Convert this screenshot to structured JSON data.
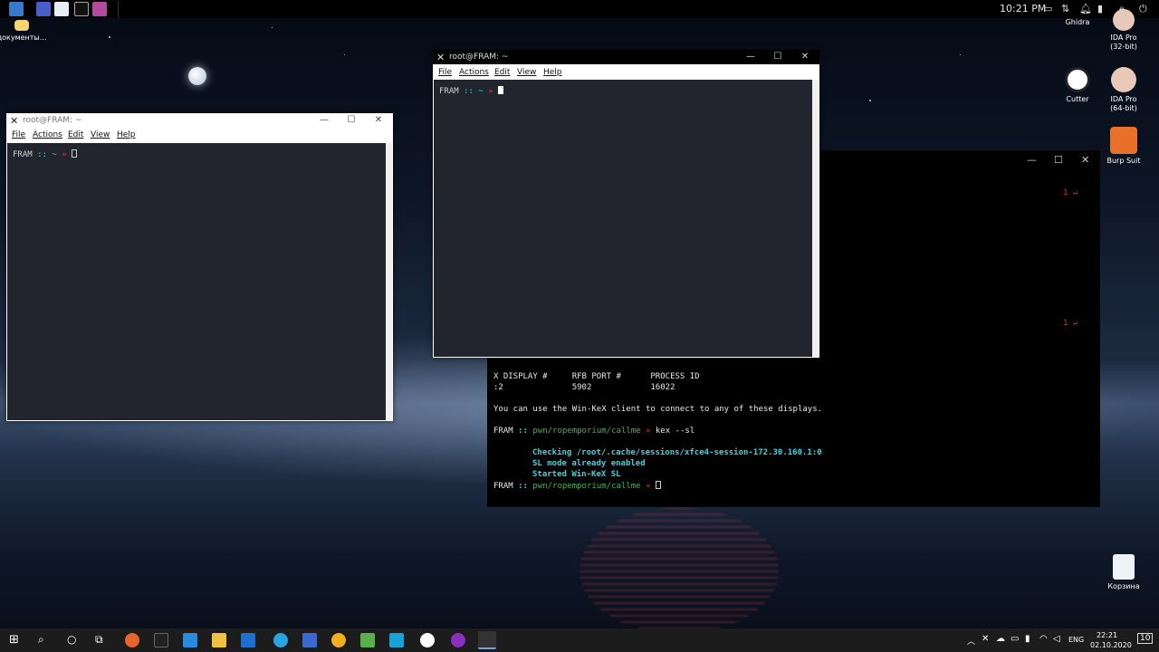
{
  "top_panel": {
    "time": "10:21 PM"
  },
  "desktop_icons": {
    "documents": "документы...",
    "ghidra": "Ghidra",
    "ida32_line1": "IDA Pro",
    "ida32_line2": "(32-bit)",
    "cutter": "Cutter",
    "ida64_line1": "IDA Pro",
    "ida64_line2": "(64-bit)",
    "burp": "Burp Suit",
    "recycle": "Корзина"
  },
  "window_left": {
    "title": "root@FRAM: ~",
    "menu": [
      "File",
      "Actions",
      "Edit",
      "View",
      "Help"
    ],
    "prompt_host": "FRAM",
    "prompt_sep": "::",
    "prompt_dir": "~",
    "prompt_arrow": "»"
  },
  "window_center": {
    "title": "root@FRAM: ~",
    "menu": [
      "File",
      "Actions",
      "Edit",
      "View",
      "Help"
    ],
    "prompt_host": "FRAM",
    "prompt_sep": "::",
    "prompt_dir": "~",
    "prompt_arrow": "»"
  },
  "black_terminal": {
    "right_marker_1": "1 ↵",
    "right_marker_2": "1 ↵",
    "header": "X DISPLAY #     RFB PORT #      PROCESS ID",
    "row": ":2              5902            16022",
    "info": "You can use the Win-KeX client to connect to any of these displays.",
    "prompt1_host": "FRAM",
    "prompt1_sep": "::",
    "prompt1_dir": "pwn/ropemporium/callme",
    "prompt1_arrow": "»",
    "prompt1_cmd": "kex --sl",
    "msg1": "Checking /root/.cache/sessions/xfce4-session-172.30.160.1:0",
    "msg2": "SL mode already enabled",
    "msg3": "Started Win-KeX SL",
    "prompt2_host": "FRAM",
    "prompt2_sep": "::",
    "prompt2_dir": "pwn/ropemporium/callme",
    "prompt2_arrow": "»"
  },
  "taskbar": {
    "lang": "ENG",
    "time": "22:21",
    "date": "02.10.2020",
    "notif_count": "10"
  }
}
